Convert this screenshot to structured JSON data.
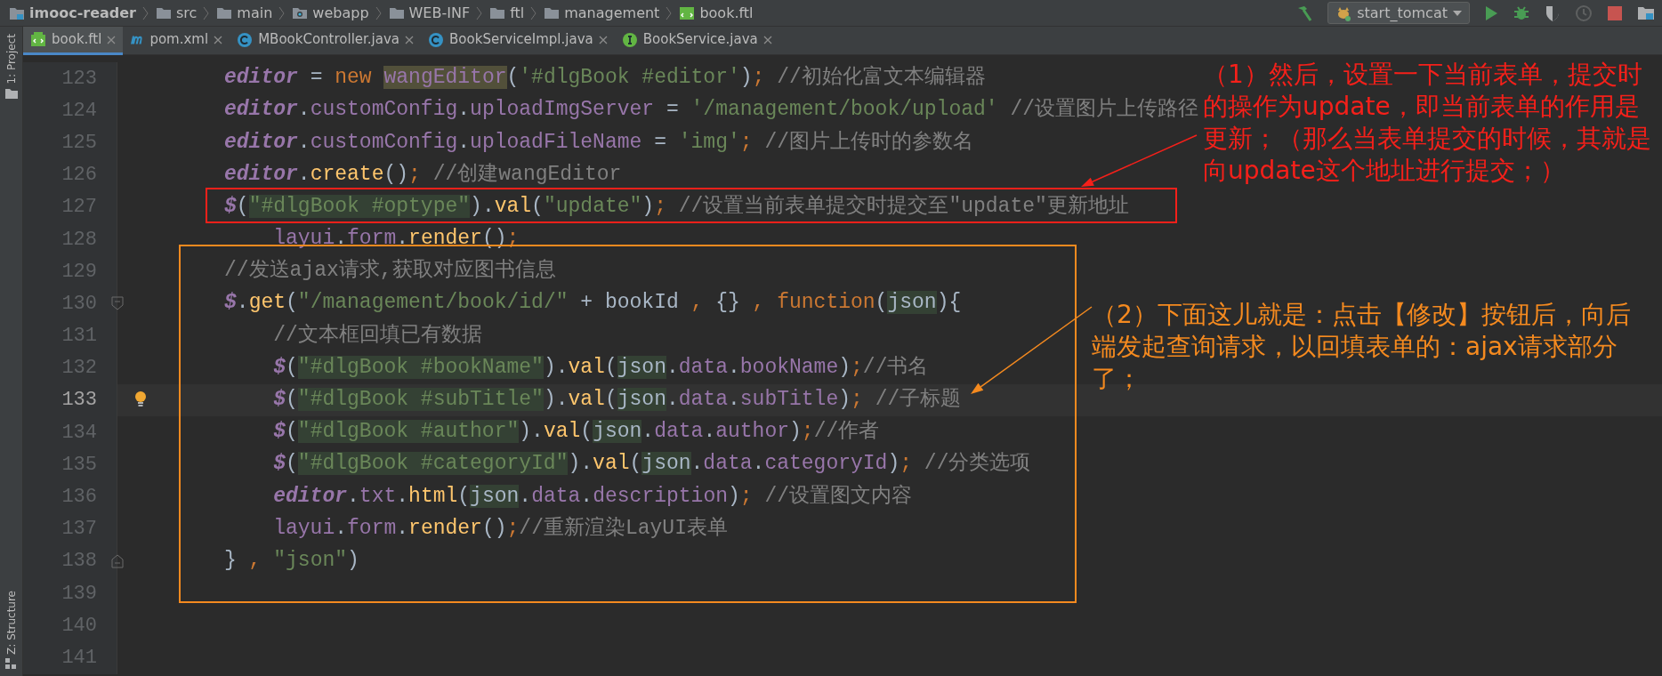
{
  "breadcrumb": [
    {
      "label": "imooc-reader",
      "kind": "module"
    },
    {
      "label": "src",
      "kind": "folder"
    },
    {
      "label": "main",
      "kind": "folder"
    },
    {
      "label": "webapp",
      "kind": "web_folder"
    },
    {
      "label": "WEB-INF",
      "kind": "folder"
    },
    {
      "label": "ftl",
      "kind": "folder"
    },
    {
      "label": "management",
      "kind": "folder"
    },
    {
      "label": "book.ftl",
      "kind": "file"
    }
  ],
  "run_config": {
    "label": "start_tomcat"
  },
  "tool_windows": [
    {
      "label": "1: Project"
    },
    {
      "label": "Z: Structure"
    }
  ],
  "tabs": [
    {
      "label": "book.ftl",
      "kind": "ftl",
      "selected": true
    },
    {
      "label": "pom.xml",
      "kind": "maven",
      "selected": false
    },
    {
      "label": "MBookController.java",
      "kind": "class",
      "selected": false
    },
    {
      "label": "BookServiceImpl.java",
      "kind": "class",
      "selected": false
    },
    {
      "label": "BookService.java",
      "kind": "interface",
      "selected": false
    }
  ],
  "lines": [
    {
      "number": "123",
      "current": false,
      "tokens": [
        {
          "kind": "var",
          "text": "editor"
        },
        {
          "kind": "plain",
          "text": " = "
        },
        {
          "kind": "keyword",
          "text": "new "
        },
        {
          "kind": "hl_prop",
          "text": "wangEditor"
        },
        {
          "kind": "plain",
          "text": "("
        },
        {
          "kind": "string",
          "text": "'#dlgBook #editor'"
        },
        {
          "kind": "plain",
          "text": ")"
        },
        {
          "kind": "keyword",
          "text": ";"
        },
        {
          "kind": "comment",
          "text": " //初始化富文本编辑器"
        }
      ]
    },
    {
      "number": "124",
      "current": false,
      "tokens": [
        {
          "kind": "var",
          "text": "editor"
        },
        {
          "kind": "plain",
          "text": "."
        },
        {
          "kind": "prop",
          "text": "customConfig"
        },
        {
          "kind": "plain",
          "text": "."
        },
        {
          "kind": "prop",
          "text": "uploadImgServer"
        },
        {
          "kind": "plain",
          "text": " = "
        },
        {
          "kind": "string",
          "text": "'/management/book/upload'"
        },
        {
          "kind": "comment",
          "text": " //设置图片上传路径"
        }
      ]
    },
    {
      "number": "125",
      "current": false,
      "tokens": [
        {
          "kind": "var",
          "text": "editor"
        },
        {
          "kind": "plain",
          "text": "."
        },
        {
          "kind": "prop",
          "text": "customConfig"
        },
        {
          "kind": "plain",
          "text": "."
        },
        {
          "kind": "prop",
          "text": "uploadFileName"
        },
        {
          "kind": "plain",
          "text": " = "
        },
        {
          "kind": "string",
          "text": "'img'"
        },
        {
          "kind": "keyword",
          "text": ";"
        },
        {
          "kind": "comment",
          "text": " //图片上传时的参数名"
        }
      ]
    },
    {
      "number": "126",
      "current": false,
      "tokens": [
        {
          "kind": "var",
          "text": "editor"
        },
        {
          "kind": "plain",
          "text": "."
        },
        {
          "kind": "func",
          "text": "create"
        },
        {
          "kind": "plain",
          "text": "()"
        },
        {
          "kind": "keyword",
          "text": ";"
        },
        {
          "kind": "comment",
          "text": " //创建wangEditor"
        }
      ]
    },
    {
      "number": "127",
      "current": false,
      "tokens": [
        {
          "kind": "var",
          "text": "$"
        },
        {
          "kind": "plain",
          "text": "("
        },
        {
          "kind": "hl_string",
          "text": "\"#dlgBook #optype\""
        },
        {
          "kind": "plain",
          "text": ")."
        },
        {
          "kind": "func",
          "text": "val"
        },
        {
          "kind": "plain",
          "text": "("
        },
        {
          "kind": "string",
          "text": "\"update\""
        },
        {
          "kind": "plain",
          "text": ")"
        },
        {
          "kind": "keyword",
          "text": ";"
        },
        {
          "kind": "comment",
          "text": " //设置当前表单提交时提交至\"update\"更新地址"
        }
      ]
    },
    {
      "number": "128",
      "current": false,
      "tokens": [
        {
          "kind": "prop",
          "text": "    layui"
        },
        {
          "kind": "plain",
          "text": "."
        },
        {
          "kind": "prop",
          "text": "form"
        },
        {
          "kind": "plain",
          "text": "."
        },
        {
          "kind": "func",
          "text": "render"
        },
        {
          "kind": "plain",
          "text": "()"
        },
        {
          "kind": "keyword",
          "text": ";"
        }
      ]
    },
    {
      "number": "129",
      "current": false,
      "tokens": [
        {
          "kind": "comment",
          "text": "//发送ajax请求,获取对应图书信息"
        }
      ]
    },
    {
      "number": "130",
      "current": false,
      "gutter": {
        "kind": "fold_start"
      },
      "tokens": [
        {
          "kind": "var",
          "text": "$"
        },
        {
          "kind": "plain",
          "text": "."
        },
        {
          "kind": "func",
          "text": "get"
        },
        {
          "kind": "plain",
          "text": "("
        },
        {
          "kind": "string",
          "text": "\"/management/book/id/\""
        },
        {
          "kind": "plain",
          "text": " + bookId "
        },
        {
          "kind": "keyword",
          "text": ","
        },
        {
          "kind": "plain",
          "text": " {} "
        },
        {
          "kind": "keyword",
          "text": ", function"
        },
        {
          "kind": "plain",
          "text": "("
        },
        {
          "kind": "hl_plain",
          "text": "json"
        },
        {
          "kind": "plain",
          "text": "){"
        }
      ]
    },
    {
      "number": "131",
      "current": false,
      "tokens": [
        {
          "kind": "comment",
          "text": "    //文本框回填已有数据"
        }
      ]
    },
    {
      "number": "132",
      "current": false,
      "tokens": [
        {
          "kind": "var",
          "text": "    $"
        },
        {
          "kind": "plain",
          "text": "("
        },
        {
          "kind": "hl_string",
          "text": "\"#dlgBook #bookName\""
        },
        {
          "kind": "plain",
          "text": ")."
        },
        {
          "kind": "func",
          "text": "val"
        },
        {
          "kind": "plain",
          "text": "("
        },
        {
          "kind": "hl_plain",
          "text": "json"
        },
        {
          "kind": "plain",
          "text": "."
        },
        {
          "kind": "prop",
          "text": "data"
        },
        {
          "kind": "plain",
          "text": "."
        },
        {
          "kind": "prop",
          "text": "bookName"
        },
        {
          "kind": "plain",
          "text": ")"
        },
        {
          "kind": "keyword",
          "text": ";"
        },
        {
          "kind": "comment",
          "text": "//书名"
        }
      ]
    },
    {
      "number": "133",
      "current": true,
      "gutter": {
        "kind": "bulb"
      },
      "tokens": [
        {
          "kind": "var",
          "text": "    $"
        },
        {
          "kind": "plain",
          "text": "("
        },
        {
          "kind": "hl_string",
          "text": "\"#dlgBook #subTitle\""
        },
        {
          "kind": "plain",
          "text": ")."
        },
        {
          "kind": "func",
          "text": "val"
        },
        {
          "kind": "plain",
          "text": "("
        },
        {
          "kind": "hl_plain",
          "text": "json"
        },
        {
          "kind": "plain",
          "text": "."
        },
        {
          "kind": "prop",
          "text": "data"
        },
        {
          "kind": "plain",
          "text": "."
        },
        {
          "kind": "prop",
          "text": "subTitle"
        },
        {
          "kind": "plain",
          "text": ")"
        },
        {
          "kind": "keyword",
          "text": ";"
        },
        {
          "kind": "comment",
          "text": " //子标题"
        }
      ]
    },
    {
      "number": "134",
      "current": false,
      "tokens": [
        {
          "kind": "var",
          "text": "    $"
        },
        {
          "kind": "plain",
          "text": "("
        },
        {
          "kind": "hl_string",
          "text": "\"#dlgBook #author\""
        },
        {
          "kind": "plain",
          "text": ")."
        },
        {
          "kind": "func",
          "text": "val"
        },
        {
          "kind": "plain",
          "text": "("
        },
        {
          "kind": "hl_plain",
          "text": "json"
        },
        {
          "kind": "plain",
          "text": "."
        },
        {
          "kind": "prop",
          "text": "data"
        },
        {
          "kind": "plain",
          "text": "."
        },
        {
          "kind": "prop",
          "text": "author"
        },
        {
          "kind": "plain",
          "text": ")"
        },
        {
          "kind": "keyword",
          "text": ";"
        },
        {
          "kind": "comment",
          "text": "//作者"
        }
      ]
    },
    {
      "number": "135",
      "current": false,
      "tokens": [
        {
          "kind": "var",
          "text": "    $"
        },
        {
          "kind": "plain",
          "text": "("
        },
        {
          "kind": "hl_string",
          "text": "\"#dlgBook #categoryId\""
        },
        {
          "kind": "plain",
          "text": ")."
        },
        {
          "kind": "func",
          "text": "val"
        },
        {
          "kind": "plain",
          "text": "("
        },
        {
          "kind": "hl_plain",
          "text": "json"
        },
        {
          "kind": "plain",
          "text": "."
        },
        {
          "kind": "prop",
          "text": "data"
        },
        {
          "kind": "plain",
          "text": "."
        },
        {
          "kind": "prop",
          "text": "categoryId"
        },
        {
          "kind": "plain",
          "text": ")"
        },
        {
          "kind": "keyword",
          "text": ";"
        },
        {
          "kind": "comment",
          "text": " //分类选项"
        }
      ]
    },
    {
      "number": "136",
      "current": false,
      "tokens": [
        {
          "kind": "var",
          "text": "    editor"
        },
        {
          "kind": "plain",
          "text": "."
        },
        {
          "kind": "prop",
          "text": "txt"
        },
        {
          "kind": "plain",
          "text": "."
        },
        {
          "kind": "func",
          "text": "html"
        },
        {
          "kind": "plain",
          "text": "("
        },
        {
          "kind": "hl_plain",
          "text": "json"
        },
        {
          "kind": "plain",
          "text": "."
        },
        {
          "kind": "prop",
          "text": "data"
        },
        {
          "kind": "plain",
          "text": "."
        },
        {
          "kind": "prop",
          "text": "description"
        },
        {
          "kind": "plain",
          "text": ")"
        },
        {
          "kind": "keyword",
          "text": ";"
        },
        {
          "kind": "comment",
          "text": " //设置图文内容"
        }
      ]
    },
    {
      "number": "137",
      "current": false,
      "tokens": [
        {
          "kind": "prop",
          "text": "    layui"
        },
        {
          "kind": "plain",
          "text": "."
        },
        {
          "kind": "prop",
          "text": "form"
        },
        {
          "kind": "plain",
          "text": "."
        },
        {
          "kind": "func",
          "text": "render"
        },
        {
          "kind": "plain",
          "text": "()"
        },
        {
          "kind": "keyword",
          "text": ";"
        },
        {
          "kind": "comment",
          "text": "//重新渲染LayUI表单"
        }
      ]
    },
    {
      "number": "138",
      "current": false,
      "gutter": {
        "kind": "fold_end"
      },
      "tokens": [
        {
          "kind": "plain",
          "text": "} "
        },
        {
          "kind": "keyword",
          "text": ","
        },
        {
          "kind": "string",
          "text": " \"json\""
        },
        {
          "kind": "plain",
          "text": ")"
        }
      ]
    },
    {
      "number": "139",
      "current": false
    },
    {
      "number": "140",
      "current": false
    },
    {
      "number": "141",
      "current": false
    }
  ],
  "annotations": [
    {
      "note": "（1）然后，设置一下当前表单，提交时的操作为update，即当前表单的作用是更新；（那么当表单提交的时候，其就是向update这个地址进行提交；）",
      "color": "#f5201a"
    },
    {
      "note": "（2）下面这儿就是：点击【修改】按钮后，向后端发起查询请求，以回填表单的：ajax请求部分了；",
      "color": "#f58a1f"
    }
  ]
}
